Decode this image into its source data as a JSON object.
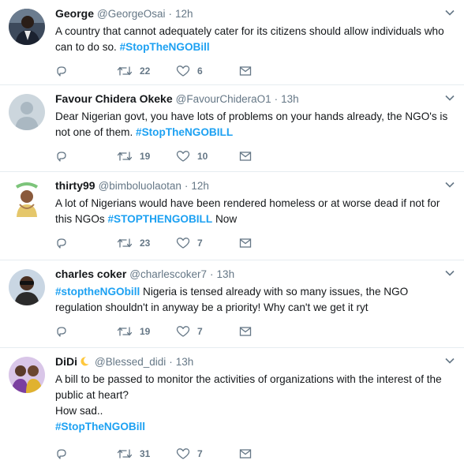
{
  "colors": {
    "accent": "#1da1f2",
    "muted": "#657786",
    "text": "#14171a",
    "divider": "#e6ecf0"
  },
  "tweets": [
    {
      "name": "George",
      "handle": "@GeorgeOsai",
      "time": "12h",
      "avatar_icon": "user-photo-icon",
      "text": "A country that cannot adequately cater for its citizens should allow individuals who can to do so.",
      "tag": "#StopTheNGOBill",
      "retweets": "22",
      "likes": "6"
    },
    {
      "name": "Favour Chidera Okeke",
      "handle": "@FavourChideraO1",
      "time": "13h",
      "avatar_icon": "default-avatar-icon",
      "text": "Dear Nigerian govt, you have lots of problems on your hands already, the NGO's is not one of them.",
      "tag": "#StopTheNGOBILL",
      "retweets": "19",
      "likes": "10"
    },
    {
      "name": "thirty99",
      "handle": "@bimboluolaotan",
      "time": "12h",
      "avatar_icon": "user-photo-icon",
      "text": "A lot of Nigerians would have been rendered homeless or at worse dead if not for this NGOs",
      "tag": "#STOPTHENGOBILL",
      "text_after": "Now",
      "retweets": "23",
      "likes": "7"
    },
    {
      "name": "charles coker",
      "handle": "@charlescoker7",
      "time": "13h",
      "avatar_icon": "user-photo-icon",
      "tag": "#stoptheNGObill",
      "text": "Nigeria is tensed already with so many issues, the NGO regulation shouldn't in anyway be a priority! Why can't we get it ryt",
      "retweets": "19",
      "likes": "7"
    },
    {
      "name": "DiDi",
      "handle": "@Blessed_didi",
      "time": "13h",
      "avatar_icon": "user-photo-icon",
      "text": "A bill to be passed to monitor the activities of organizations with the interest of the public at heart?",
      "text_line2": "How sad..",
      "tag": "#StopTheNGOBill",
      "retweets": "31",
      "likes": "7"
    }
  ]
}
